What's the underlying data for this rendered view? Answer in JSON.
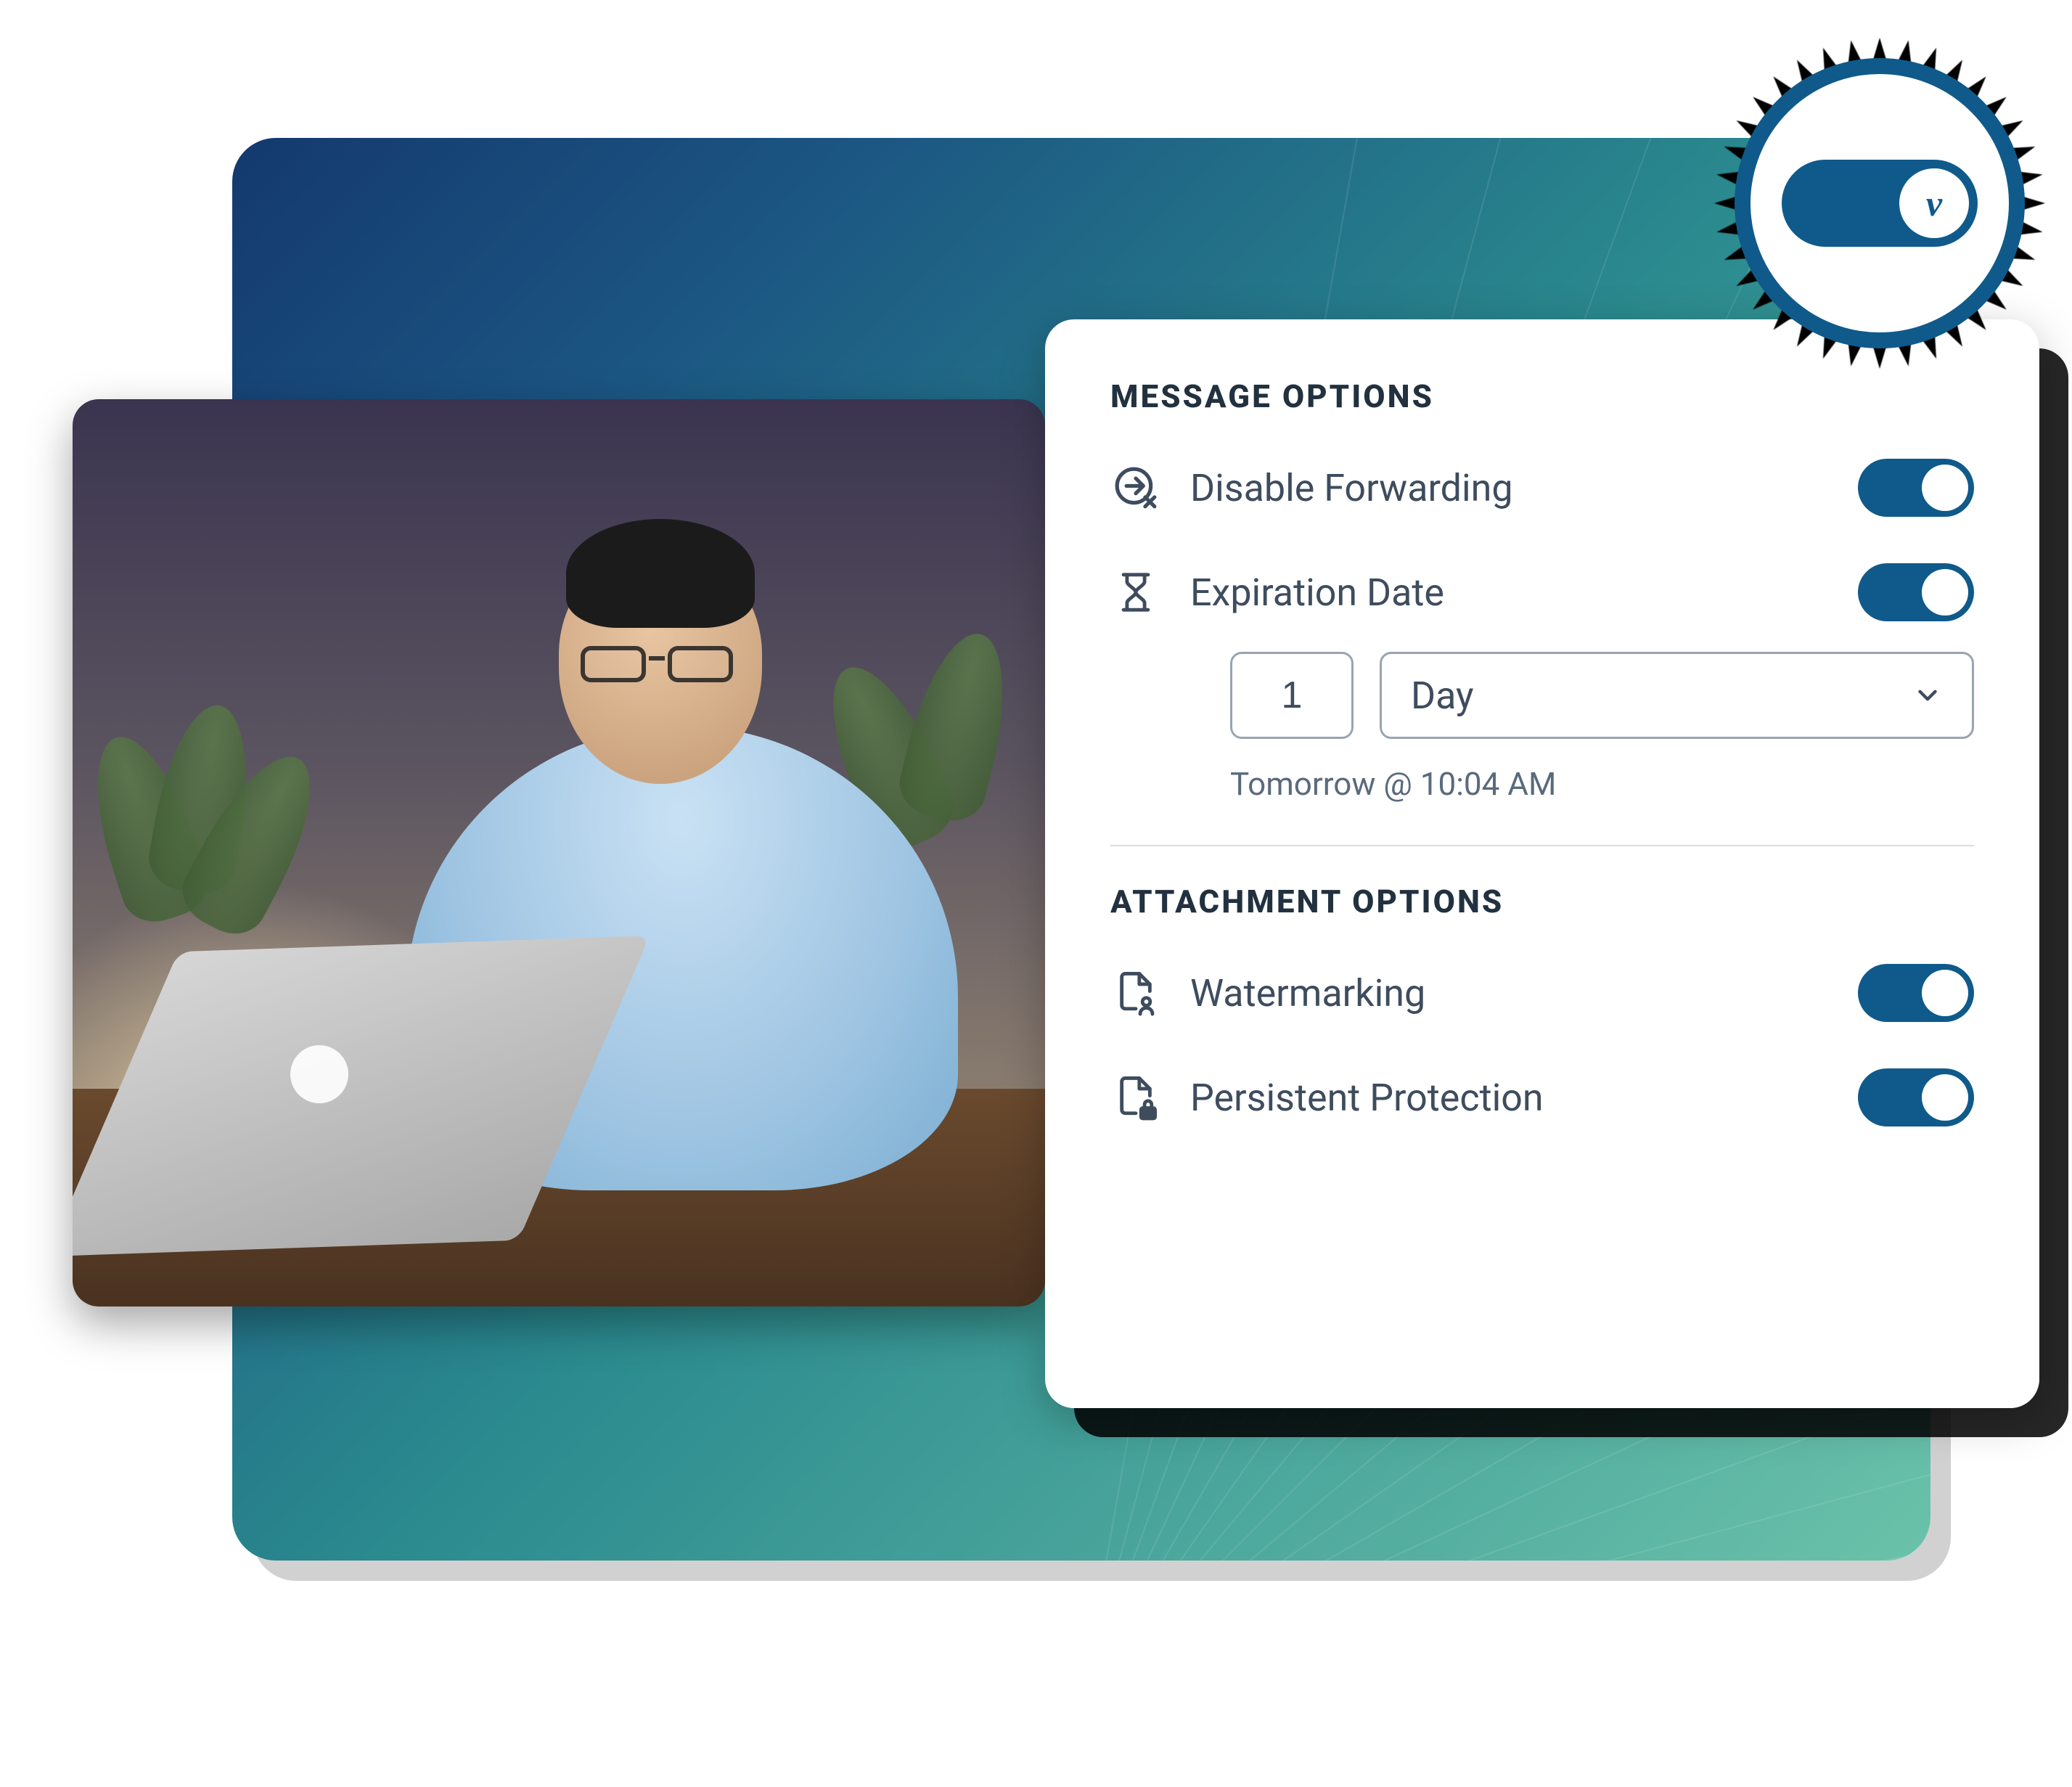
{
  "colors": {
    "accent": "#0f5a8a",
    "text": "#3e4c5e",
    "muted": "#5a6a7d",
    "border": "#9aa4b2"
  },
  "message_options": {
    "title": "MESSAGE OPTIONS",
    "disable_forwarding": {
      "label": "Disable Forwarding",
      "icon": "forward-disabled-icon",
      "enabled": true
    },
    "expiration_date": {
      "label": "Expiration Date",
      "icon": "hourglass-icon",
      "enabled": true,
      "count": "1",
      "unit": "Day",
      "hint": "Tomorrow @ 10:04 AM"
    }
  },
  "attachment_options": {
    "title": "ATTACHMENT OPTIONS",
    "watermarking": {
      "label": "Watermarking",
      "icon": "file-user-icon",
      "enabled": true
    },
    "persistent_protection": {
      "label": "Persistent Protection",
      "icon": "file-lock-icon",
      "enabled": true
    }
  },
  "badge": {
    "toggle_state": "on",
    "knob_glyph": "v"
  }
}
